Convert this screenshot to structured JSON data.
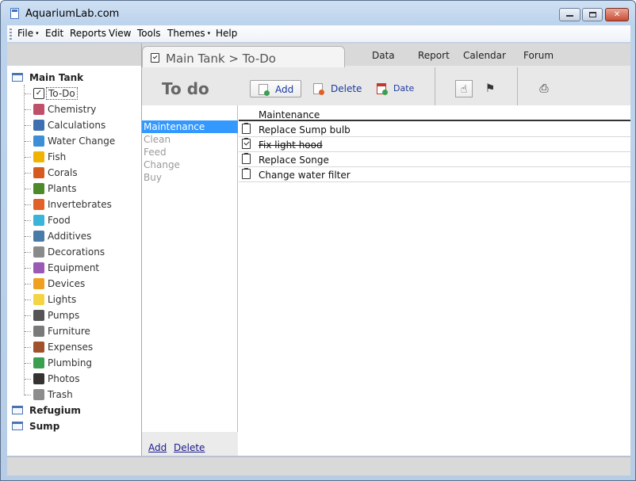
{
  "window": {
    "title": "AquariumLab.com",
    "icon": "page-icon"
  },
  "menubar": [
    {
      "label": "File",
      "has_dropdown": true
    },
    {
      "label": "Edit",
      "has_dropdown": false
    },
    {
      "label": "Reports",
      "has_dropdown": false
    },
    {
      "label": "View",
      "has_dropdown": false
    },
    {
      "label": "Tools",
      "has_dropdown": false
    },
    {
      "label": "Themes",
      "has_dropdown": true
    },
    {
      "label": "Help",
      "has_dropdown": false
    }
  ],
  "dropdown_caret": "▾",
  "sidebar": {
    "groups": [
      {
        "label": "Main Tank",
        "icon": "tank-icon"
      },
      {
        "label": "Refugium",
        "icon": "tank-icon"
      },
      {
        "label": "Sump",
        "icon": "tank-icon"
      }
    ],
    "items": [
      {
        "label": "To-Do",
        "icon": "checklist-icon",
        "color": "#ffffff",
        "selected": true
      },
      {
        "label": "Chemistry",
        "icon": "chemistry-icon",
        "color": "#c0506a"
      },
      {
        "label": "Calculations",
        "icon": "calculator-icon",
        "color": "#3e6fb0"
      },
      {
        "label": "Water Change",
        "icon": "water-change-icon",
        "color": "#3c8ed6"
      },
      {
        "label": "Fish",
        "icon": "fish-icon",
        "color": "#f0b400"
      },
      {
        "label": "Corals",
        "icon": "coral-icon",
        "color": "#d65a20"
      },
      {
        "label": "Plants",
        "icon": "plant-icon",
        "color": "#4d8a2a"
      },
      {
        "label": "Invertebrates",
        "icon": "starfish-icon",
        "color": "#e2602a"
      },
      {
        "label": "Food",
        "icon": "food-icon",
        "color": "#3ab4d8"
      },
      {
        "label": "Additives",
        "icon": "dropper-icon",
        "color": "#4a7aa8"
      },
      {
        "label": "Decorations",
        "icon": "decoration-icon",
        "color": "#8a8a8a"
      },
      {
        "label": "Equipment",
        "icon": "equipment-icon",
        "color": "#9b59b6"
      },
      {
        "label": "Devices",
        "icon": "lightning-icon",
        "color": "#f0a020"
      },
      {
        "label": "Lights",
        "icon": "lightbulb-icon",
        "color": "#f4d442"
      },
      {
        "label": "Pumps",
        "icon": "pump-icon",
        "color": "#555555"
      },
      {
        "label": "Furniture",
        "icon": "furniture-icon",
        "color": "#7a7a7a"
      },
      {
        "label": "Expenses",
        "icon": "expenses-icon",
        "color": "#a0522d"
      },
      {
        "label": "Plumbing",
        "icon": "pipe-icon",
        "color": "#3aa050"
      },
      {
        "label": "Photos",
        "icon": "camera-icon",
        "color": "#333333"
      },
      {
        "label": "Trash",
        "icon": "trash-icon",
        "color": "#8c8c8c"
      }
    ]
  },
  "header": {
    "breadcrumb_tab": "Main Tank > To-Do",
    "top_tabs": [
      "Data",
      "Report",
      "Calendar",
      "Forum"
    ],
    "page_title": "To do",
    "toolbar": {
      "add_label": "Add",
      "delete_label": "Delete",
      "date_label": "Date"
    },
    "icons": [
      "hand-pointer-icon",
      "hand-flag-icon",
      "print-icon"
    ]
  },
  "categories": {
    "items": [
      "Maintenance",
      "Clean",
      "Feed",
      "Change",
      "Buy"
    ],
    "selected": "Maintenance",
    "footer": {
      "add_label": "Add",
      "delete_label": "Delete"
    }
  },
  "todo": {
    "column_header": "Maintenance",
    "rows": [
      {
        "text": "Replace Sump bulb",
        "done": false
      },
      {
        "text": "Fix light hood",
        "done": true
      },
      {
        "text": "Replace Songe",
        "done": false
      },
      {
        "text": "Change water filter",
        "done": false
      }
    ]
  },
  "colors": {
    "selection": "#3399ff",
    "link": "#1a3aa0",
    "accent_red": "#c74d36"
  }
}
